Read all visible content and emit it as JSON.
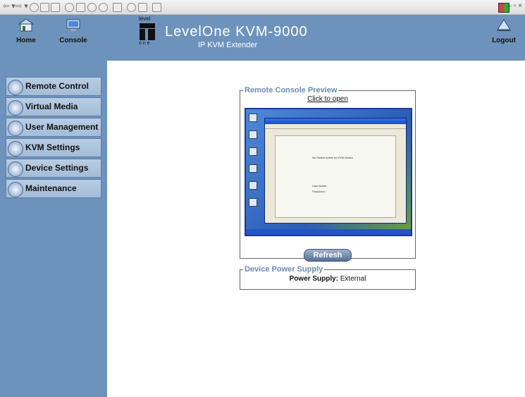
{
  "colors": {
    "header_blue": "#6d93bd",
    "legend_blue": "#6b8bb7",
    "nav_bg": "#aec5de"
  },
  "header": {
    "home_label": "Home",
    "console_label": "Console",
    "logout_label": "Logout",
    "brand_top": "level",
    "brand_bottom": "one",
    "product_name": "LevelOne KVM-9000",
    "product_sub": "IP KVM Extender"
  },
  "nav": {
    "items": [
      {
        "label": "Remote Control",
        "icon": "monitor-icon"
      },
      {
        "label": "Virtual Media",
        "icon": "disc-icon"
      },
      {
        "label": "User Management",
        "icon": "users-icon"
      },
      {
        "label": "KVM Settings",
        "icon": "keyboard-icon"
      },
      {
        "label": "Device Settings",
        "icon": "gears-icon"
      },
      {
        "label": "Maintenance",
        "icon": "wrench-icon"
      }
    ]
  },
  "preview": {
    "legend": "Remote Console Preview",
    "click_to_open": "Click to open",
    "refresh_label": "Refresh",
    "screen_line1": "No Switch Active by KVM-Switch",
    "screen_user": "User Name :",
    "screen_pass": "Password  :"
  },
  "power": {
    "legend": "Device Power Supply",
    "label": "Power Supply:",
    "value": "External"
  }
}
